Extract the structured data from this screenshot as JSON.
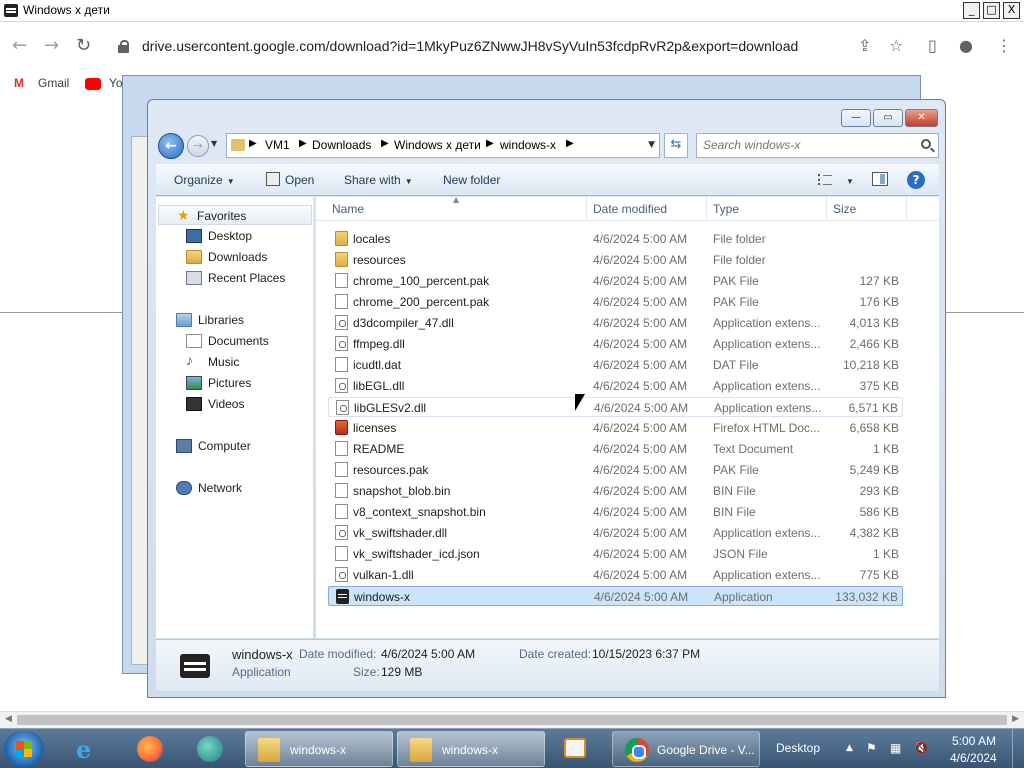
{
  "host": {
    "title": "Windows x дети",
    "min": "_",
    "max": "□",
    "close": "X"
  },
  "browser": {
    "url": "drive.usercontent.google.com/download?id=1MkyPuz6ZNwwJH8vSyVuIn53fcdpRvR2p&export=download",
    "bookmarks": [
      "Gmail",
      "Yo"
    ]
  },
  "explorer": {
    "breadcrumb": [
      "VM1",
      "Downloads",
      "Windows x дети",
      "windows-x"
    ],
    "search_placeholder": "Search windows-x",
    "commands": {
      "organize": "Organize",
      "open": "Open",
      "share": "Share with",
      "new_folder": "New folder"
    },
    "nav": {
      "favorites": "Favorites",
      "favorites_items": [
        "Desktop",
        "Downloads",
        "Recent Places"
      ],
      "libraries": "Libraries",
      "libraries_items": [
        "Documents",
        "Music",
        "Pictures",
        "Videos"
      ],
      "computer": "Computer",
      "network": "Network"
    },
    "columns": {
      "name": "Name",
      "date": "Date modified",
      "type": "Type",
      "size": "Size"
    },
    "files": [
      {
        "name": "locales",
        "date": "4/6/2024 5:00 AM",
        "type": "File folder",
        "size": "",
        "icon": "folder-icon"
      },
      {
        "name": "resources",
        "date": "4/6/2024 5:00 AM",
        "type": "File folder",
        "size": "",
        "icon": "folder-icon"
      },
      {
        "name": "chrome_100_percent.pak",
        "date": "4/6/2024 5:00 AM",
        "type": "PAK File",
        "size": "127 KB",
        "icon": "file-icon"
      },
      {
        "name": "chrome_200_percent.pak",
        "date": "4/6/2024 5:00 AM",
        "type": "PAK File",
        "size": "176 KB",
        "icon": "file-icon"
      },
      {
        "name": "d3dcompiler_47.dll",
        "date": "4/6/2024 5:00 AM",
        "type": "Application extens...",
        "size": "4,013 KB",
        "icon": "dll-icon"
      },
      {
        "name": "ffmpeg.dll",
        "date": "4/6/2024 5:00 AM",
        "type": "Application extens...",
        "size": "2,466 KB",
        "icon": "dll-icon"
      },
      {
        "name": "icudtl.dat",
        "date": "4/6/2024 5:00 AM",
        "type": "DAT File",
        "size": "10,218 KB",
        "icon": "file-icon"
      },
      {
        "name": "libEGL.dll",
        "date": "4/6/2024 5:00 AM",
        "type": "Application extens...",
        "size": "375 KB",
        "icon": "dll-icon"
      },
      {
        "name": "libGLESv2.dll",
        "date": "4/6/2024 5:00 AM",
        "type": "Application extens...",
        "size": "6,571 KB",
        "icon": "dll-icon"
      },
      {
        "name": "licenses",
        "date": "4/6/2024 5:00 AM",
        "type": "Firefox HTML Doc...",
        "size": "6,658 KB",
        "icon": "html-icon"
      },
      {
        "name": "README",
        "date": "4/6/2024 5:00 AM",
        "type": "Text Document",
        "size": "1 KB",
        "icon": "file-icon"
      },
      {
        "name": "resources.pak",
        "date": "4/6/2024 5:00 AM",
        "type": "PAK File",
        "size": "5,249 KB",
        "icon": "file-icon"
      },
      {
        "name": "snapshot_blob.bin",
        "date": "4/6/2024 5:00 AM",
        "type": "BIN File",
        "size": "293 KB",
        "icon": "file-icon"
      },
      {
        "name": "v8_context_snapshot.bin",
        "date": "4/6/2024 5:00 AM",
        "type": "BIN File",
        "size": "586 KB",
        "icon": "file-icon"
      },
      {
        "name": "vk_swiftshader.dll",
        "date": "4/6/2024 5:00 AM",
        "type": "Application extens...",
        "size": "4,382 KB",
        "icon": "dll-icon"
      },
      {
        "name": "vk_swiftshader_icd.json",
        "date": "4/6/2024 5:00 AM",
        "type": "JSON File",
        "size": "1 KB",
        "icon": "file-icon"
      },
      {
        "name": "vulkan-1.dll",
        "date": "4/6/2024 5:00 AM",
        "type": "Application extens...",
        "size": "775 KB",
        "icon": "dll-icon"
      },
      {
        "name": "windows-x",
        "date": "4/6/2024 5:00 AM",
        "type": "Application",
        "size": "133,032 KB",
        "icon": "app-icon"
      }
    ],
    "hovered_file": "libGLESv2.dll",
    "selected_file": "windows-x",
    "details": {
      "name": "windows-x",
      "type": "Application",
      "modified_label": "Date modified:",
      "modified_value": "4/6/2024 5:00 AM",
      "created_label": "Date created:",
      "created_value": "10/15/2023 6:37 PM",
      "size_label": "Size:",
      "size_value": "129 MB"
    }
  },
  "taskbar": {
    "tasks": [
      "windows-x",
      "windows-x",
      "Google Drive - V..."
    ],
    "desktop": "Desktop",
    "time": "5:00 AM",
    "date": "4/6/2024"
  },
  "colors": {
    "selection": "#cce4f7",
    "taskbar": "#3a5573",
    "accent": "#2a6fbf"
  }
}
